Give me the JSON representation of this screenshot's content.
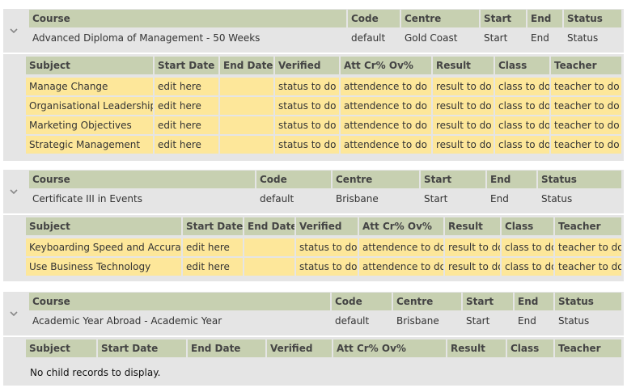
{
  "courses": [
    {
      "course_headers": [
        "Course",
        "Code",
        "Centre",
        "Start",
        "End",
        "Status"
      ],
      "course_values": [
        "Advanced Diploma of Management - 50 Weeks",
        "default",
        "Gold Coast",
        "Start",
        "End",
        "Status"
      ],
      "subject_headers": [
        "Subject",
        "Start Date",
        "End Date",
        "Verified",
        "Att Cr% Ov%",
        "Result",
        "Class",
        "Teacher"
      ],
      "subjects": [
        [
          "Manage Change",
          "edit here",
          "",
          "status to do",
          "attendence to do",
          "result to do",
          "class to do",
          "teacher to do"
        ],
        [
          "Organisational Leadership",
          "edit here",
          "",
          "status to do",
          "attendence to do",
          "result to do",
          "class to do",
          "teacher to do"
        ],
        [
          "Marketing Objectives",
          "edit here",
          "",
          "status to do",
          "attendence to do",
          "result to do",
          "class to do",
          "teacher to do"
        ],
        [
          "Strategic Management",
          "edit here",
          "",
          "status to do",
          "attendence to do",
          "result to do",
          "class to do",
          "teacher to do"
        ]
      ],
      "empty_message": ""
    },
    {
      "course_headers": [
        "Course",
        "Code",
        "Centre",
        "Start",
        "End",
        "Status"
      ],
      "course_values": [
        "Certificate III in Events",
        "default",
        "Brisbane",
        "Start",
        "End",
        "Status"
      ],
      "subject_headers": [
        "Subject",
        "Start Date",
        "End Date",
        "Verified",
        "Att Cr% Ov%",
        "Result",
        "Class",
        "Teacher"
      ],
      "subjects": [
        [
          "Keyboarding Speed and Accuracy",
          "edit here",
          "",
          "status to do",
          "attendence to do",
          "result to do",
          "class to do",
          "teacher to do"
        ],
        [
          "Use Business Technology",
          "edit here",
          "",
          "status to do",
          "attendence to do",
          "result to do",
          "class to do",
          "teacher to do"
        ]
      ],
      "empty_message": ""
    },
    {
      "course_headers": [
        "Course",
        "Code",
        "Centre",
        "Start",
        "End",
        "Status"
      ],
      "course_values": [
        "Academic Year Abroad - Academic Year",
        "default",
        "Brisbane",
        "Start",
        "End",
        "Status"
      ],
      "subject_headers": [
        "Subject",
        "Start Date",
        "End Date",
        "Verified",
        "Att Cr% Ov%",
        "Result",
        "Class",
        "Teacher"
      ],
      "subjects": [],
      "empty_message": "No child records to display."
    }
  ],
  "icons": {
    "expand_toggle": "chevron-down-icon"
  },
  "colors": {
    "header_bg": "#c7d0b1",
    "row_highlight": "#fde79a",
    "panel_bg": "#e5e5e5"
  }
}
